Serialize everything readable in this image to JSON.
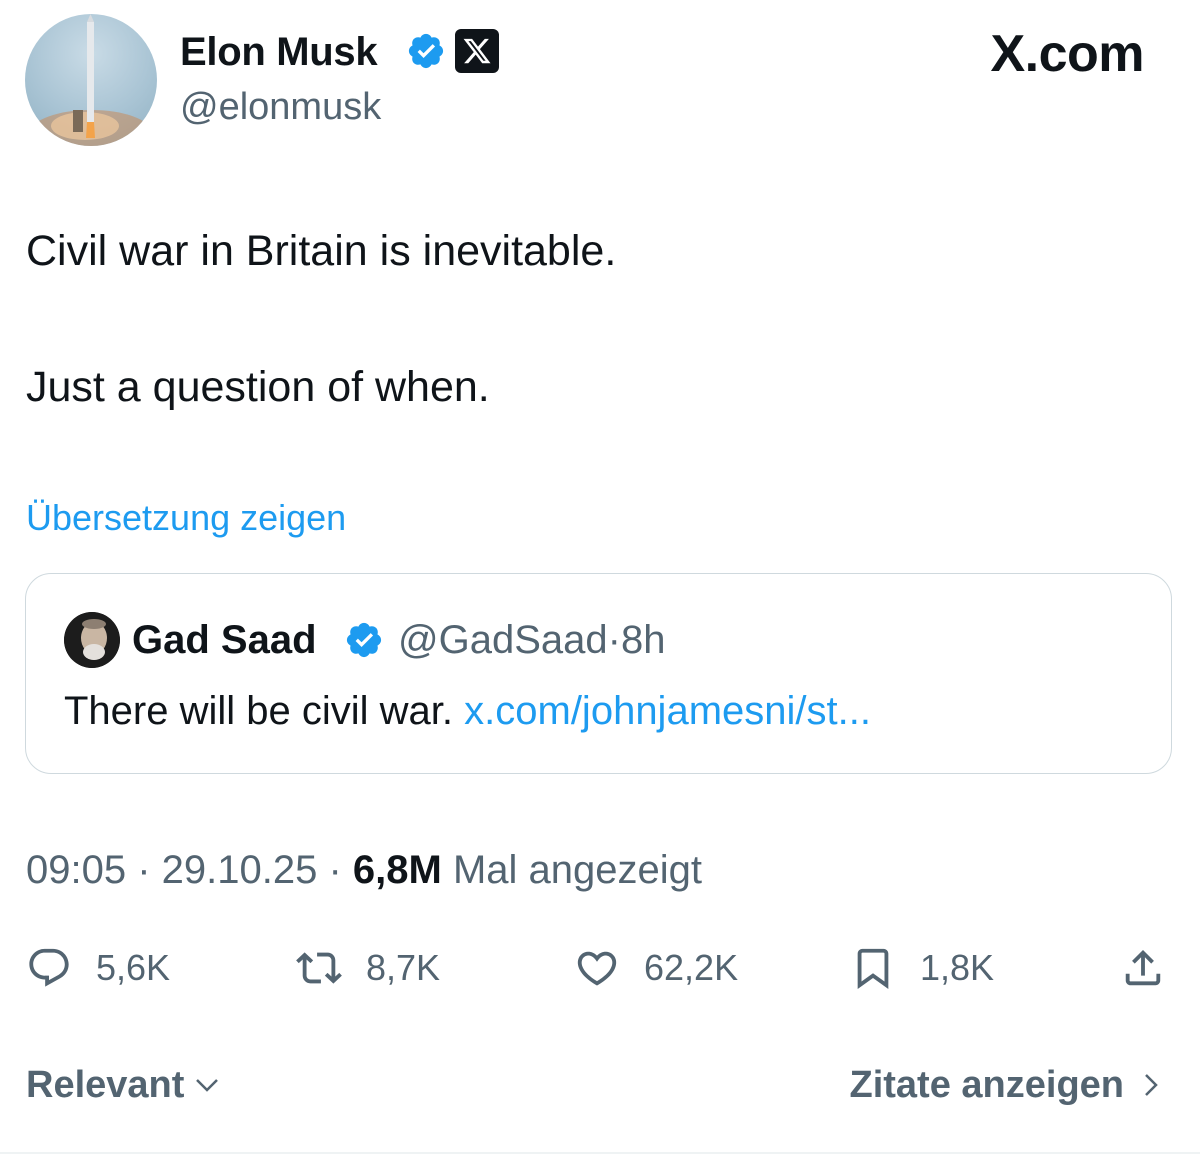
{
  "author": {
    "name": "Elon Musk",
    "handle": "@elonmusk"
  },
  "brand": "X.com",
  "tweet": {
    "lines": [
      "Civil war in Britain is inevitable.",
      "Just a question of when."
    ],
    "translate_label": "Übersetzung zeigen"
  },
  "quoted": {
    "name": "Gad Saad",
    "handle": "@GadSaad",
    "separator": "·",
    "age": "8h",
    "text": "There will be civil war.",
    "link": "x.com/johnjamesni/st..."
  },
  "meta": {
    "time": "09:05",
    "sep1": " · ",
    "date": "29.10.25",
    "sep2": " · ",
    "views": "6,8M",
    "views_label": "Mal angezeigt"
  },
  "actions": {
    "replies": "5,6K",
    "reposts": "8,7K",
    "likes": "62,2K",
    "bookmarks": "1,8K"
  },
  "footer": {
    "sort_label": "Relevant",
    "quotes_label": "Zitate anzeigen"
  },
  "colors": {
    "link": "#1d9bf0",
    "secondary": "#536471",
    "primary": "#0f1419",
    "verified": "#1d9bf0"
  },
  "icons": {
    "verified": "verified-badge-icon",
    "x_logo": "x-logo-icon",
    "reply": "reply-icon",
    "repost": "repost-icon",
    "like": "heart-icon",
    "bookmark": "bookmark-icon",
    "share": "share-icon",
    "chevron_down": "chevron-down-icon",
    "chevron_right": "chevron-right-icon"
  }
}
